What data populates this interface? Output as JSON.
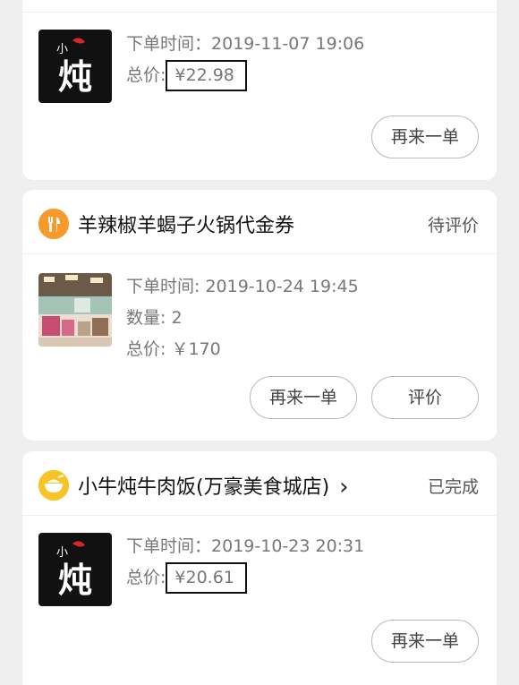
{
  "orders": [
    {
      "order_time_label": "下单时间：",
      "order_time": "2019-11-07 19:06",
      "total_label": "总价:",
      "total": "¥22.98",
      "buttons": {
        "reorder": "再来一单"
      }
    },
    {
      "shop_name": "羊辣椒羊蝎子火锅代金券",
      "status": "待评价",
      "order_time_label": "下单时间:",
      "order_time": "2019-10-24 19:45",
      "quantity_label": "数量:",
      "quantity": "2",
      "total_label": "总价:",
      "total": "￥170",
      "buttons": {
        "reorder": "再来一单",
        "review": "评价"
      }
    },
    {
      "shop_name": "小牛炖牛肉饭(万豪美食城店)",
      "shop_arrow": "›",
      "status": "已完成",
      "order_time_label": "下单时间：",
      "order_time": "2019-10-23 20:31",
      "total_label": "总价:",
      "total": "¥20.61",
      "buttons": {
        "reorder": "再来一单"
      }
    }
  ],
  "logo_text": "小炖",
  "icons": {
    "voucher": "fork-knife-icon",
    "shop": "rice-bowl-icon"
  },
  "colors": {
    "accent_orange": "#f79a2a",
    "accent_yellow": "#f7c325",
    "status_text": "#555555"
  }
}
